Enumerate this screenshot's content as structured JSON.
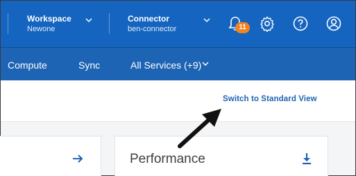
{
  "header": {
    "workspace": {
      "title": "Workspace",
      "value": "Newone"
    },
    "connector": {
      "title": "Connector",
      "value": "ben-connector"
    },
    "notifications": {
      "count": "11"
    },
    "colors": {
      "header_bg": "#1565c0",
      "badge": "#f58220"
    }
  },
  "nav": {
    "items": [
      {
        "label": "Compute"
      },
      {
        "label": "Sync"
      },
      {
        "label": "All Services (+9)"
      }
    ]
  },
  "toolbar": {
    "switch_view_label": "Switch to Standard View"
  },
  "cards": {
    "performance_title": "Performance"
  },
  "icons": [
    "chevron-down-icon",
    "bell-icon",
    "gear-icon",
    "help-icon",
    "user-icon",
    "arrow-right-icon",
    "download-icon"
  ]
}
